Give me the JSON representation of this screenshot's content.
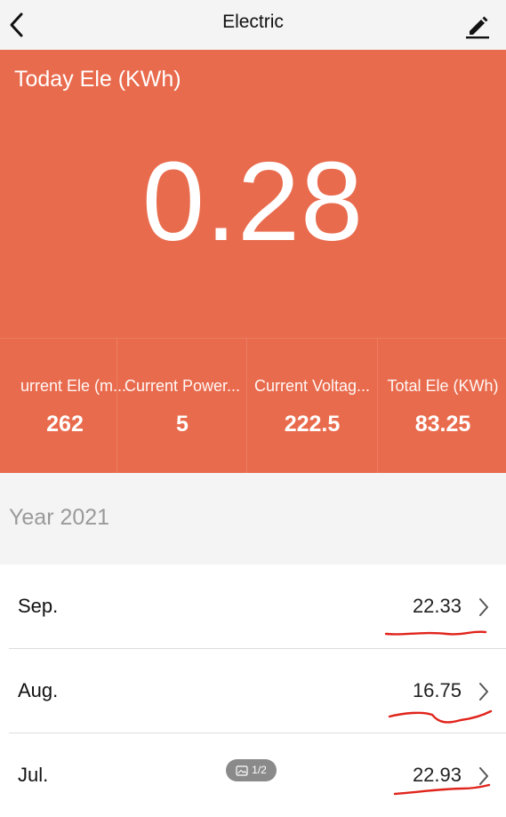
{
  "nav": {
    "title": "Electric"
  },
  "hero": {
    "label": "Today Ele (KWh)",
    "value": "0.28",
    "background_color": "#e96b4d"
  },
  "stats": [
    {
      "label": "urrent Ele (m...",
      "value": "262"
    },
    {
      "label": "Current Power...",
      "value": "5"
    },
    {
      "label": "Current Voltag...",
      "value": "222.5"
    },
    {
      "label": "Total Ele (KWh)",
      "value": "83.25"
    }
  ],
  "year": {
    "label": "Year 2021"
  },
  "months": [
    {
      "name": "Sep.",
      "value": "22.33"
    },
    {
      "name": "Aug.",
      "value": "16.75"
    },
    {
      "name": "Jul.",
      "value": "22.93"
    }
  ],
  "annotation": {
    "color": "#e0241b"
  },
  "page_badge": {
    "text": "1/2",
    "icon": "image-icon"
  }
}
